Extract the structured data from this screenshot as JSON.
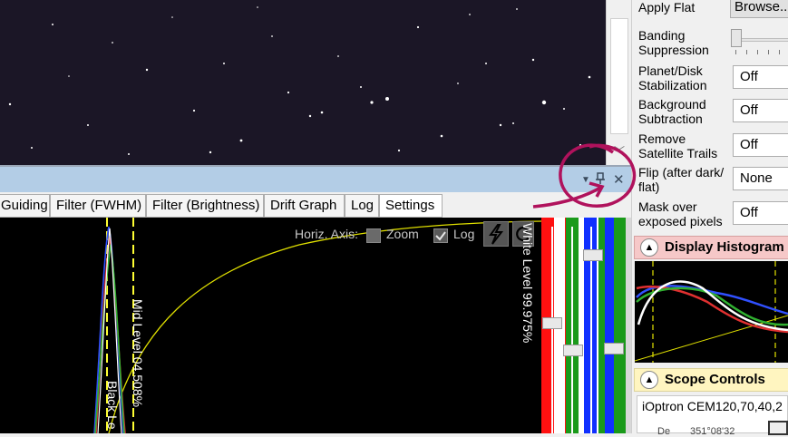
{
  "right_panel": {
    "apply_flat_label": "Apply Flat",
    "browse_label": "Browse...",
    "banding_label": "Banding Suppression",
    "planet_label": "Planet/Disk Stabilization",
    "planet_value": "Off",
    "background_label": "Background Subtraction",
    "background_value": "Off",
    "sat_label": "Remove Satellite Trails",
    "sat_value": "Off",
    "flip_label": "Flip (after dark/ flat)",
    "flip_value": "None",
    "mask_label": "Mask over exposed pixels",
    "mask_value": "Off",
    "display_histogram_title": "Display Histogram S",
    "scope_controls_title": "Scope Controls",
    "mount_name": "iOptron CEM120,70,40,2",
    "mount_coords": "351°08'32"
  },
  "panel_bar": {
    "dropdown_icon": "▼",
    "pin_icon": "pin",
    "close_icon": "✕"
  },
  "tabs": [
    {
      "label": "Guiding"
    },
    {
      "label": "Filter (FWHM)"
    },
    {
      "label": "Filter (Brightness)"
    },
    {
      "label": "Drift Graph"
    },
    {
      "label": "Log"
    },
    {
      "label": "Settings"
    }
  ],
  "graph": {
    "horiz_axis_label": "Horiz. Axis:",
    "zoom_label": "Zoom",
    "log_label": "Log",
    "white_level_label": "White Level  99.975%",
    "mid_level_label": "Mid Level  04.508%",
    "black_level_label": "Black Le"
  },
  "colors": {
    "panel_bar": "#b3cde6",
    "display_hist_header": "#f6c8c8",
    "scope_header": "#fff5c0",
    "annotation": "#b0125c"
  }
}
